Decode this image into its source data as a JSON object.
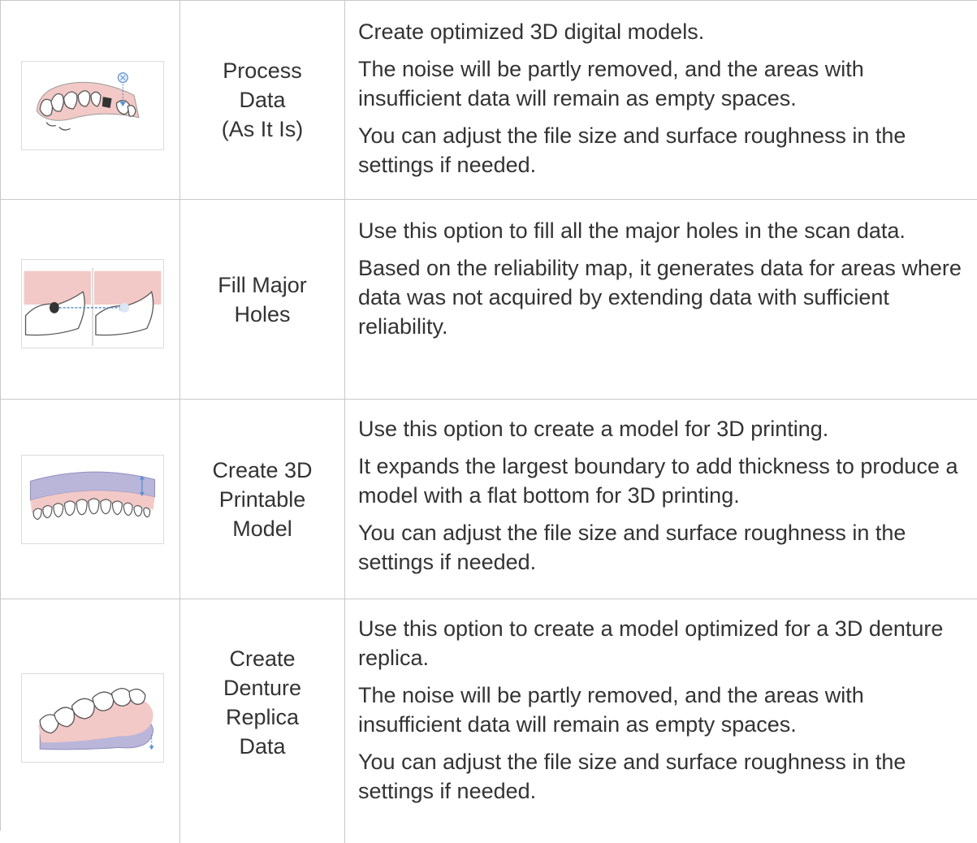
{
  "rows": [
    {
      "image_icon": "dental-arch-process-icon",
      "name": "Process\nData\n(As It Is)",
      "desc": [
        "Create optimized 3D digital models.",
        "The noise will be partly removed, and the areas with insufficient data will remain as empty spaces.",
        "You can adjust the file size and surface roughness in the settings if needed."
      ]
    },
    {
      "image_icon": "fill-holes-icon",
      "name": "Fill Major\nHoles",
      "desc": [
        "Use this option to fill all the major holes in the scan data.",
        "Based on the reliability map, it generates data for areas where data was not acquired by extending data with sufficient reliability."
      ]
    },
    {
      "image_icon": "printable-model-icon",
      "name": "Create 3D\nPrintable\nModel",
      "desc": [
        "Use this option to create a model for 3D printing.",
        "It expands the largest boundary to add thickness to produce a model with a flat bottom for 3D printing.",
        "You can adjust the file size and surface roughness in the settings if needed."
      ]
    },
    {
      "image_icon": "denture-replica-icon",
      "name": "Create\nDenture\nReplica\nData",
      "desc": [
        "Use this option to create a model optimized for a 3D denture replica.",
        "The noise will be partly removed, and the areas with insufficient data will remain as empty spaces.",
        "You can adjust the file size and surface roughness in the settings if needed."
      ]
    }
  ],
  "colors": {
    "gum": "#f2c9c6",
    "tooth": "#ffffff",
    "outline": "#555555",
    "accent_blue": "#5b8ed6",
    "base_lavender": "#b9b6da"
  }
}
